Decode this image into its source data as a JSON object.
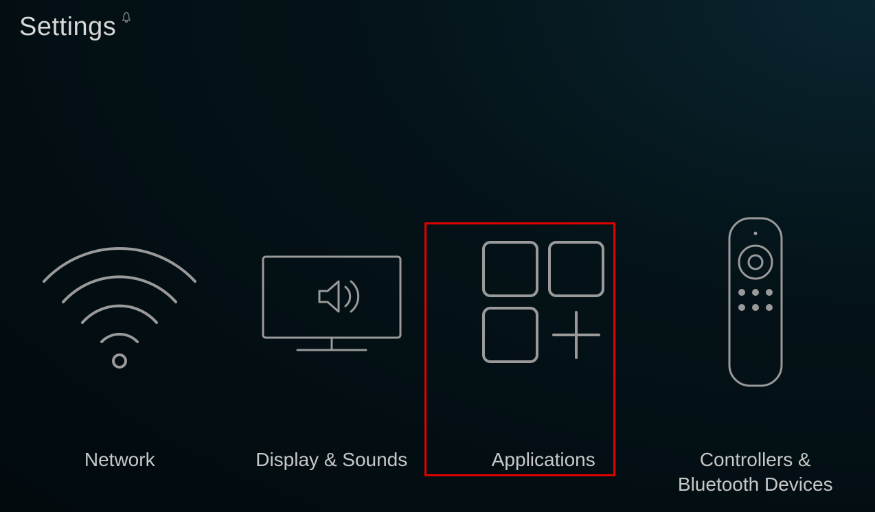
{
  "header": {
    "title": "Settings"
  },
  "tiles": [
    {
      "id": "network",
      "label": "Network",
      "icon": "wifi-icon",
      "highlighted": false
    },
    {
      "id": "display-sounds",
      "label": "Display & Sounds",
      "icon": "tv-sound-icon",
      "highlighted": false
    },
    {
      "id": "applications",
      "label": "Applications",
      "icon": "apps-icon",
      "highlighted": true
    },
    {
      "id": "controllers",
      "label": "Controllers & Bluetooth Devices",
      "icon": "remote-icon",
      "highlighted": false
    }
  ],
  "colors": {
    "highlight": "#e00000",
    "icon_stroke": "#9a9a9a",
    "text": "#c8c8c8",
    "background_dark": "#020a0e"
  }
}
